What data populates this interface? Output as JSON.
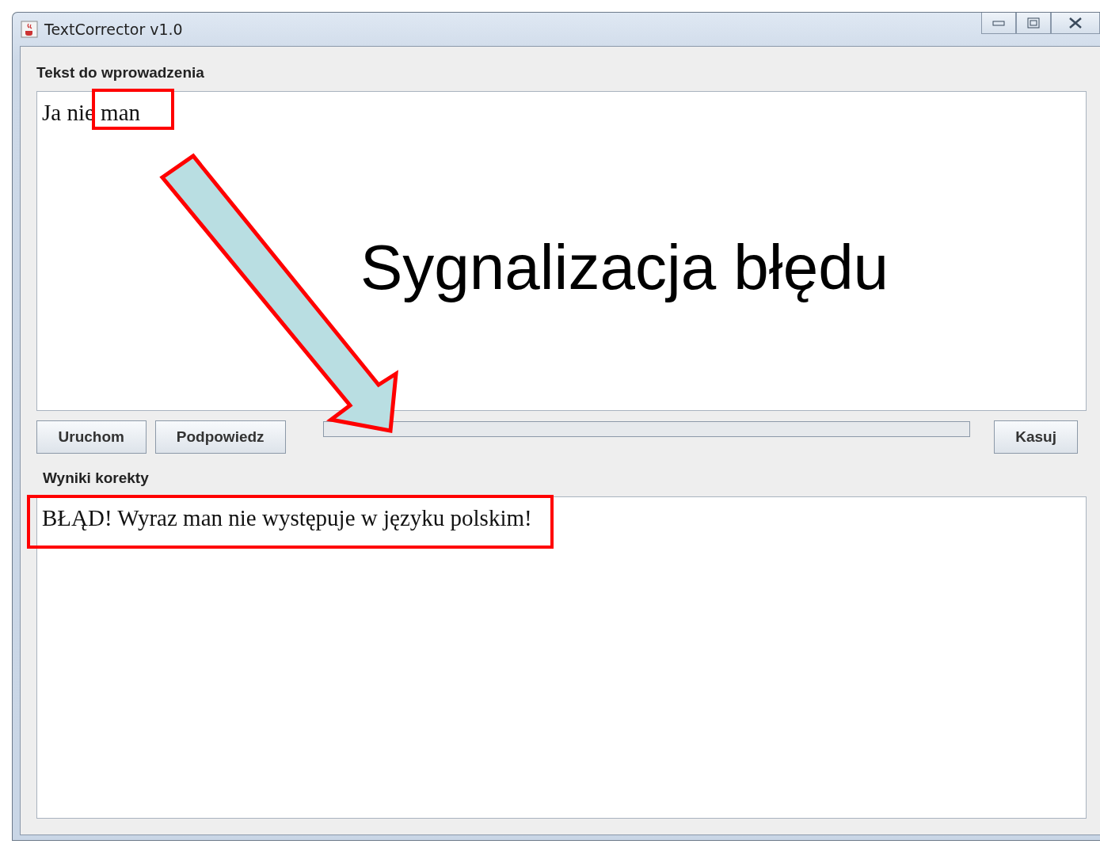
{
  "window": {
    "title": "TextCorrector v1.0"
  },
  "input_section": {
    "label": "Tekst do wprowadzenia",
    "text": "Ja nie man"
  },
  "buttons": [
    {
      "label": "Uruchom"
    },
    {
      "label": "Podpowiedz"
    }
  ],
  "clear_button": {
    "label": "Kasuj"
  },
  "results_section": {
    "label": "Wyniki korekty",
    "text": "BŁĄD! Wyraz man nie występuje w języku polskim!"
  },
  "annotation": {
    "caption": "Sygnalizacja błędu"
  }
}
